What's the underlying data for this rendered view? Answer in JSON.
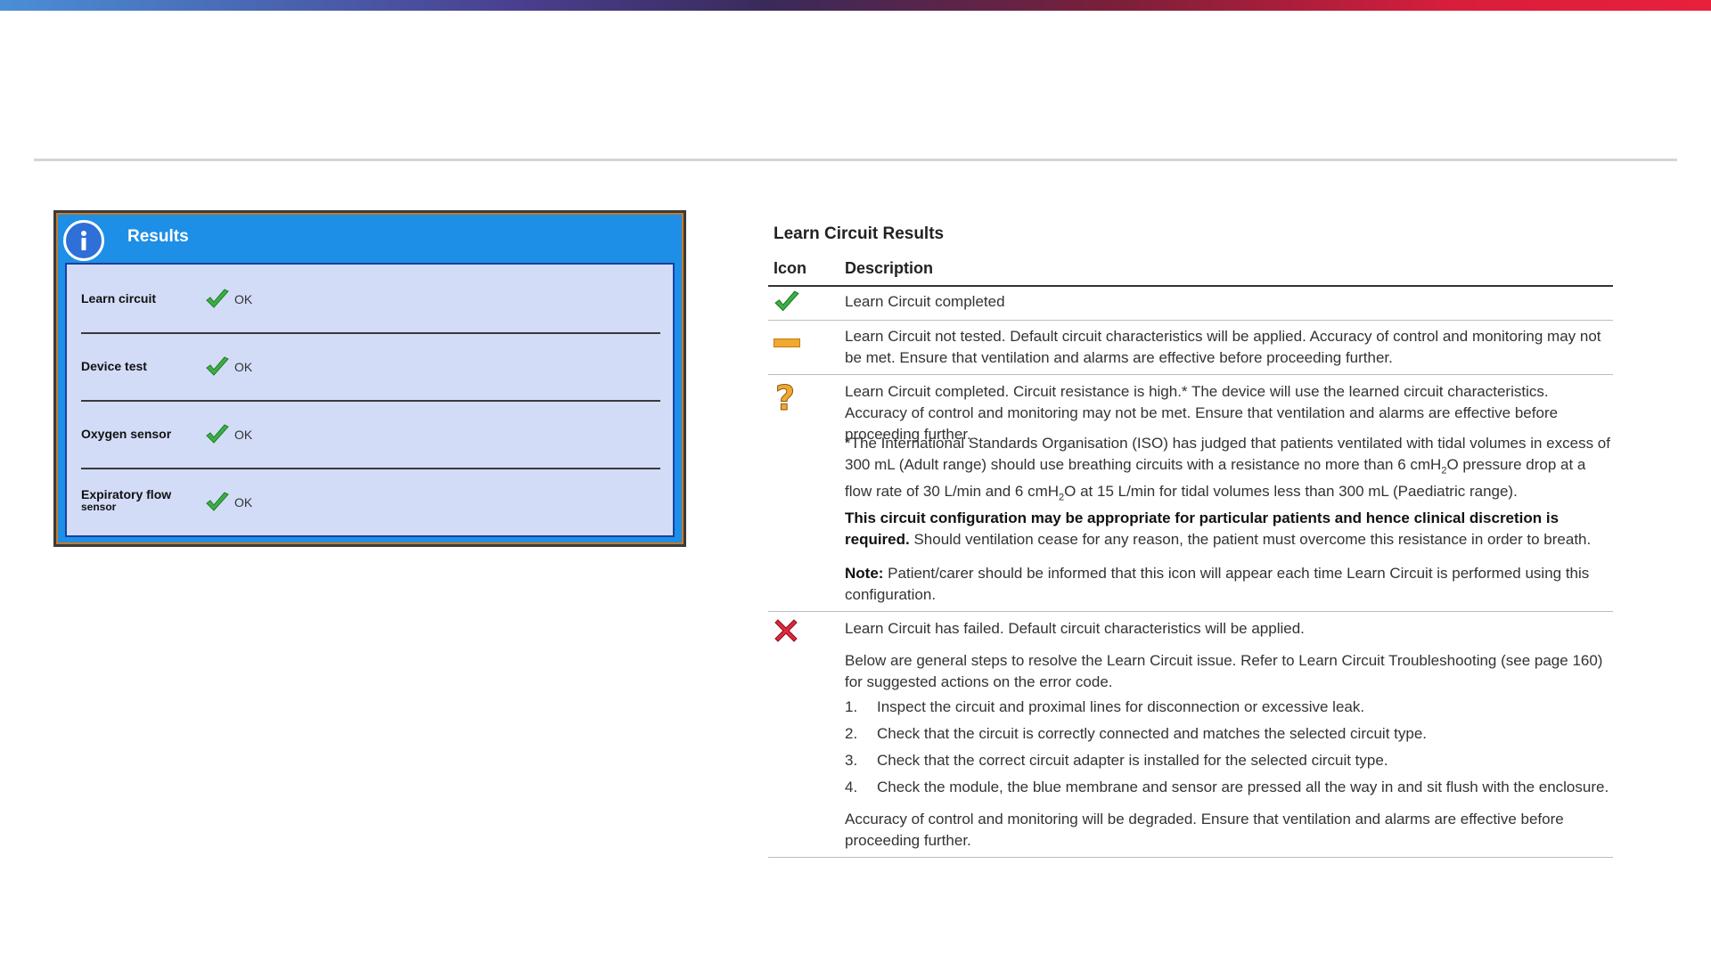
{
  "panel": {
    "title": "Results",
    "rows": [
      {
        "label": "Learn circuit",
        "status": "OK"
      },
      {
        "label": "Device test",
        "status": "OK"
      },
      {
        "label": "Oxygen sensor",
        "status": "OK"
      },
      {
        "label_line1": "Expiratory flow",
        "label_line2": "sensor",
        "status": "OK"
      }
    ]
  },
  "table": {
    "title": "Learn Circuit Results",
    "col_icon": "Icon",
    "col_description": "Description",
    "rows": [
      {
        "icon": "green-check-icon",
        "text": "Learn Circuit completed"
      },
      {
        "icon": "orange-dash-icon",
        "text": "Learn Circuit not tested. Default circuit characteristics will be applied. Accuracy of control and monitoring may not be met. Ensure that ventilation and alarms are effective before proceeding further."
      },
      {
        "icon": "orange-question-icon",
        "text": "Learn Circuit completed. Circuit resistance is high.* The device will use the learned circuit characteristics. Accuracy of control and monitoring may not be met. Ensure that ventilation and alarms are effective before proceeding further.",
        "footnote_a": "*The International Standards Organisation (ISO) has judged that patients ventilated with tidal volumes in excess of 300 mL (Adult range) should use breathing circuits with a resistance no more than 6 cmH",
        "footnote_sub1": "2",
        "footnote_b": "O pressure drop at a flow rate of 30 L/min and 6 cmH",
        "footnote_sub2": "2",
        "footnote_c": "O at 15 L/min for tidal volumes less than 300 mL (Paediatric range).",
        "bold_text": "This circuit configuration may be appropriate for particular patients and hence clinical discretion is required.",
        "bold_tail": " Should ventilation cease for any reason, the patient must overcome this resistance in order to breath.",
        "note_label": "Note:",
        "note_text": " Patient/carer should be informed that this icon will appear each time Learn Circuit is performed using this configuration."
      },
      {
        "icon": "red-x-icon",
        "text": "Learn Circuit has failed. Default circuit characteristics will be applied.",
        "steps_intro": "Below are general steps to resolve the Learn Circuit issue. Refer to Learn Circuit Troubleshooting (see page 160) for suggested actions on the error code.",
        "steps": [
          {
            "num": "1.",
            "text": "Inspect the circuit and proximal lines for disconnection or excessive leak."
          },
          {
            "num": "2.",
            "text": "Check that the circuit is correctly connected and matches the selected circuit type."
          },
          {
            "num": "3.",
            "text": "Check that the correct circuit adapter is installed for the selected circuit type."
          },
          {
            "num": "4.",
            "text": "Check the module, the blue membrane and sensor are pressed all the way in and sit flush with the enclosure."
          }
        ],
        "closing": "Accuracy of control and monitoring will be degraded. Ensure that ventilation and alarms are effective before proceeding further."
      }
    ]
  }
}
